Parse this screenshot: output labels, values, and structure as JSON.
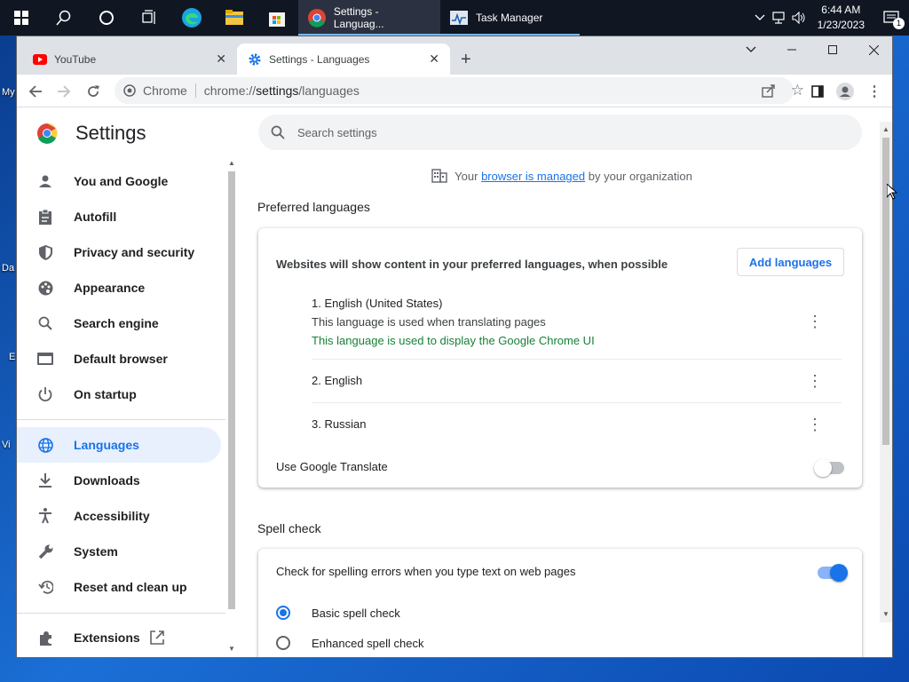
{
  "taskbar": {
    "apps": [
      {
        "label": "Settings - Languag...",
        "icon": "chrome-icon"
      },
      {
        "label": "Task Manager",
        "icon": "task-manager-icon"
      }
    ],
    "clock": {
      "time": "6:44 AM",
      "date": "1/23/2023"
    },
    "notifications": "1"
  },
  "desktop": {
    "labels": [
      "My",
      "Da",
      "E",
      "Vi"
    ]
  },
  "tabs": [
    {
      "label": "YouTube",
      "icon": "youtube-icon"
    },
    {
      "label": "Settings - Languages",
      "icon": "gear-icon"
    }
  ],
  "omnibox": {
    "site": "Chrome",
    "url_prefix": "chrome://",
    "url_host": "settings",
    "url_path": "/languages"
  },
  "settings": {
    "title": "Settings",
    "search_placeholder": "Search settings",
    "sidebar": [
      {
        "label": "You and Google",
        "icon": "person-icon"
      },
      {
        "label": "Autofill",
        "icon": "clipboard-icon"
      },
      {
        "label": "Privacy and security",
        "icon": "shield-icon"
      },
      {
        "label": "Appearance",
        "icon": "palette-icon"
      },
      {
        "label": "Search engine",
        "icon": "search-icon"
      },
      {
        "label": "Default browser",
        "icon": "browser-icon"
      },
      {
        "label": "On startup",
        "icon": "power-icon"
      },
      {
        "label": "Languages",
        "icon": "globe-icon"
      },
      {
        "label": "Downloads",
        "icon": "download-icon"
      },
      {
        "label": "Accessibility",
        "icon": "accessibility-icon"
      },
      {
        "label": "System",
        "icon": "wrench-icon"
      },
      {
        "label": "Reset and clean up",
        "icon": "restore-icon"
      },
      {
        "label": "Extensions",
        "icon": "puzzle-icon"
      }
    ]
  },
  "managed": {
    "prefix": "Your",
    "link": "browser is managed",
    "suffix": "by your organization"
  },
  "preferred": {
    "title": "Preferred languages",
    "description": "Websites will show content in your preferred languages, when possible",
    "add_button": "Add languages",
    "languages": [
      {
        "name": "1. English (United States)",
        "note1": "This language is used when translating pages",
        "note2": "This language is used to display the Google Chrome UI"
      },
      {
        "name": "2. English"
      },
      {
        "name": "3. Russian"
      }
    ],
    "translate_label": "Use Google Translate",
    "translate_on": false
  },
  "spell": {
    "title": "Spell check",
    "check_label": "Check for spelling errors when you type text on web pages",
    "check_on": true,
    "options": [
      {
        "label": "Basic spell check",
        "selected": true
      },
      {
        "label": "Enhanced spell check",
        "selected": false
      }
    ]
  },
  "colors": {
    "accent": "#1a73e8",
    "green_note": "#188038"
  }
}
